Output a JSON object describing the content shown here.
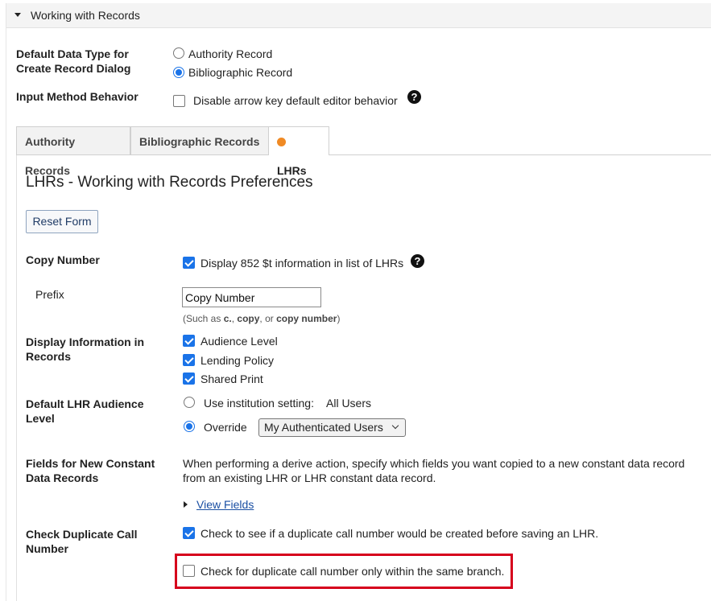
{
  "section": {
    "title": "Working with Records"
  },
  "default_data_type": {
    "label_line1": "Default Data Type for",
    "label_line2": "Create Record Dialog",
    "options": [
      {
        "label": "Authority Record",
        "checked": false
      },
      {
        "label": "Bibliographic Record",
        "checked": true
      }
    ]
  },
  "input_method": {
    "label": "Input Method Behavior",
    "checkbox_label": "Disable arrow key default editor behavior",
    "checked": false,
    "help_glyph": "?"
  },
  "tabs": [
    {
      "label": "Authority Records",
      "active": false
    },
    {
      "label": "Bibliographic Records",
      "active": false
    },
    {
      "label": "LHRs",
      "active": true
    }
  ],
  "panel": {
    "title": "LHRs - Working with Records Preferences",
    "reset_button": "Reset Form"
  },
  "copy_number": {
    "label": "Copy Number",
    "checkbox_label": "Display 852 $t information in list of LHRs",
    "checked": true,
    "help_glyph": "?",
    "prefix_label": "Prefix",
    "prefix_value": "Copy Number",
    "hint_pre": "(Such as ",
    "hint_ex1": "c.",
    "hint_sep1": ", ",
    "hint_ex2": "copy",
    "hint_sep2": ", or ",
    "hint_ex3": "copy number",
    "hint_post": ")"
  },
  "display_info": {
    "label_line1": "Display Information in",
    "label_line2": "Records",
    "items": [
      {
        "label": "Audience Level",
        "checked": true
      },
      {
        "label": "Lending Policy",
        "checked": true
      },
      {
        "label": "Shared Print",
        "checked": true
      }
    ]
  },
  "audience_level": {
    "label_line1": "Default LHR Audience",
    "label_line2": "Level",
    "option_institution": "Use institution setting:",
    "institution_value": "All Users",
    "option_override": "Override",
    "override_checked": true,
    "override_select": "My Authenticated Users"
  },
  "constant_fields": {
    "label_line1": "Fields for New Constant",
    "label_line2": "Data Records",
    "description_line1": "When performing a derive action, specify which fields you want copied to a new constant data record",
    "description_line2": "from an existing LHR or LHR constant data record.",
    "view_fields_link": "View Fields"
  },
  "duplicate_call": {
    "label_line1": "Check Duplicate Call",
    "label_line2": "Number",
    "check_label": "Check to see if a duplicate call number would be created before saving an LHR.",
    "check_checked": true,
    "branch_label": "Check for duplicate call number only within the same branch.",
    "branch_checked": false
  },
  "colors": {
    "accent": "#1a73e8",
    "highlight_border": "#d6001c",
    "active_tab_dot": "#f08a24"
  }
}
